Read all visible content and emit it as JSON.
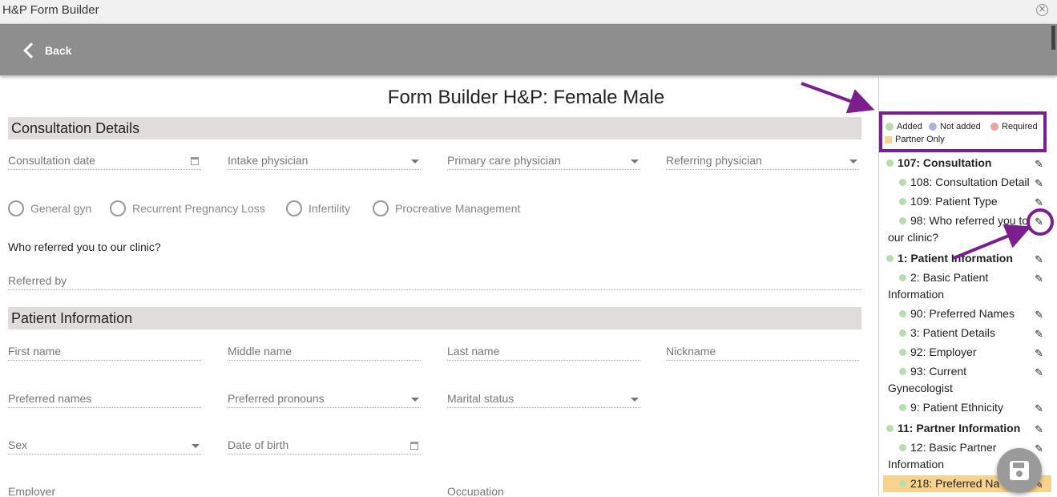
{
  "window": {
    "title": "H&P Form Builder",
    "close_glyph": "✕"
  },
  "header": {
    "back_label": "Back"
  },
  "page": {
    "title": "Form Builder H&P: Female Male"
  },
  "sections": {
    "consultation": {
      "title": "Consultation Details",
      "fields": {
        "consultation_date": "Consultation date",
        "intake_physician": "Intake physician",
        "primary_care_physician": "Primary care physician",
        "referring_physician": "Referring physician"
      },
      "radios": [
        "General gyn",
        "Recurrent Pregnancy Loss",
        "Infertility",
        "Procreative Management"
      ],
      "question": "Who referred you to our clinic?",
      "referred_by": "Referred by"
    },
    "patient": {
      "title": "Patient Information",
      "fields": {
        "first_name": "First name",
        "middle_name": "Middle name",
        "last_name": "Last name",
        "nickname": "Nickname",
        "preferred_names": "Preferred names",
        "preferred_pronouns": "Preferred pronouns",
        "marital_status": "Marital status",
        "sex": "Sex",
        "date_of_birth": "Date of birth",
        "employer": "Employer",
        "occupation": "Occupation"
      }
    }
  },
  "legend": {
    "added": "Added",
    "not_added": "Not added",
    "required": "Required",
    "partner_only": "Partner Only",
    "colors": {
      "added": "#b7dcae",
      "not_added": "#aab4e6",
      "required": "#e8a2a2",
      "partner_only": "#f7d48f"
    }
  },
  "tree": [
    {
      "label": "107: Consultation"
    },
    {
      "label": "108: Consultation Detail"
    },
    {
      "label": "109: Patient Type"
    },
    {
      "label": "98: Who referred you to",
      "label2": "our clinic?"
    },
    {
      "label": "1: Patient Information"
    },
    {
      "label": "2: Basic Patient",
      "label2": "Information"
    },
    {
      "label": "90: Preferred Names"
    },
    {
      "label": "3: Patient Details"
    },
    {
      "label": "92: Employer"
    },
    {
      "label": "93: Current",
      "label2": "Gynecologist"
    },
    {
      "label": "9: Patient Ethnicity"
    },
    {
      "label": "11: Partner Information"
    },
    {
      "label": "12: Basic Partner",
      "label2": "Information"
    },
    {
      "label": "218: Preferred Na"
    }
  ],
  "icons": {
    "pencil": "✎"
  }
}
